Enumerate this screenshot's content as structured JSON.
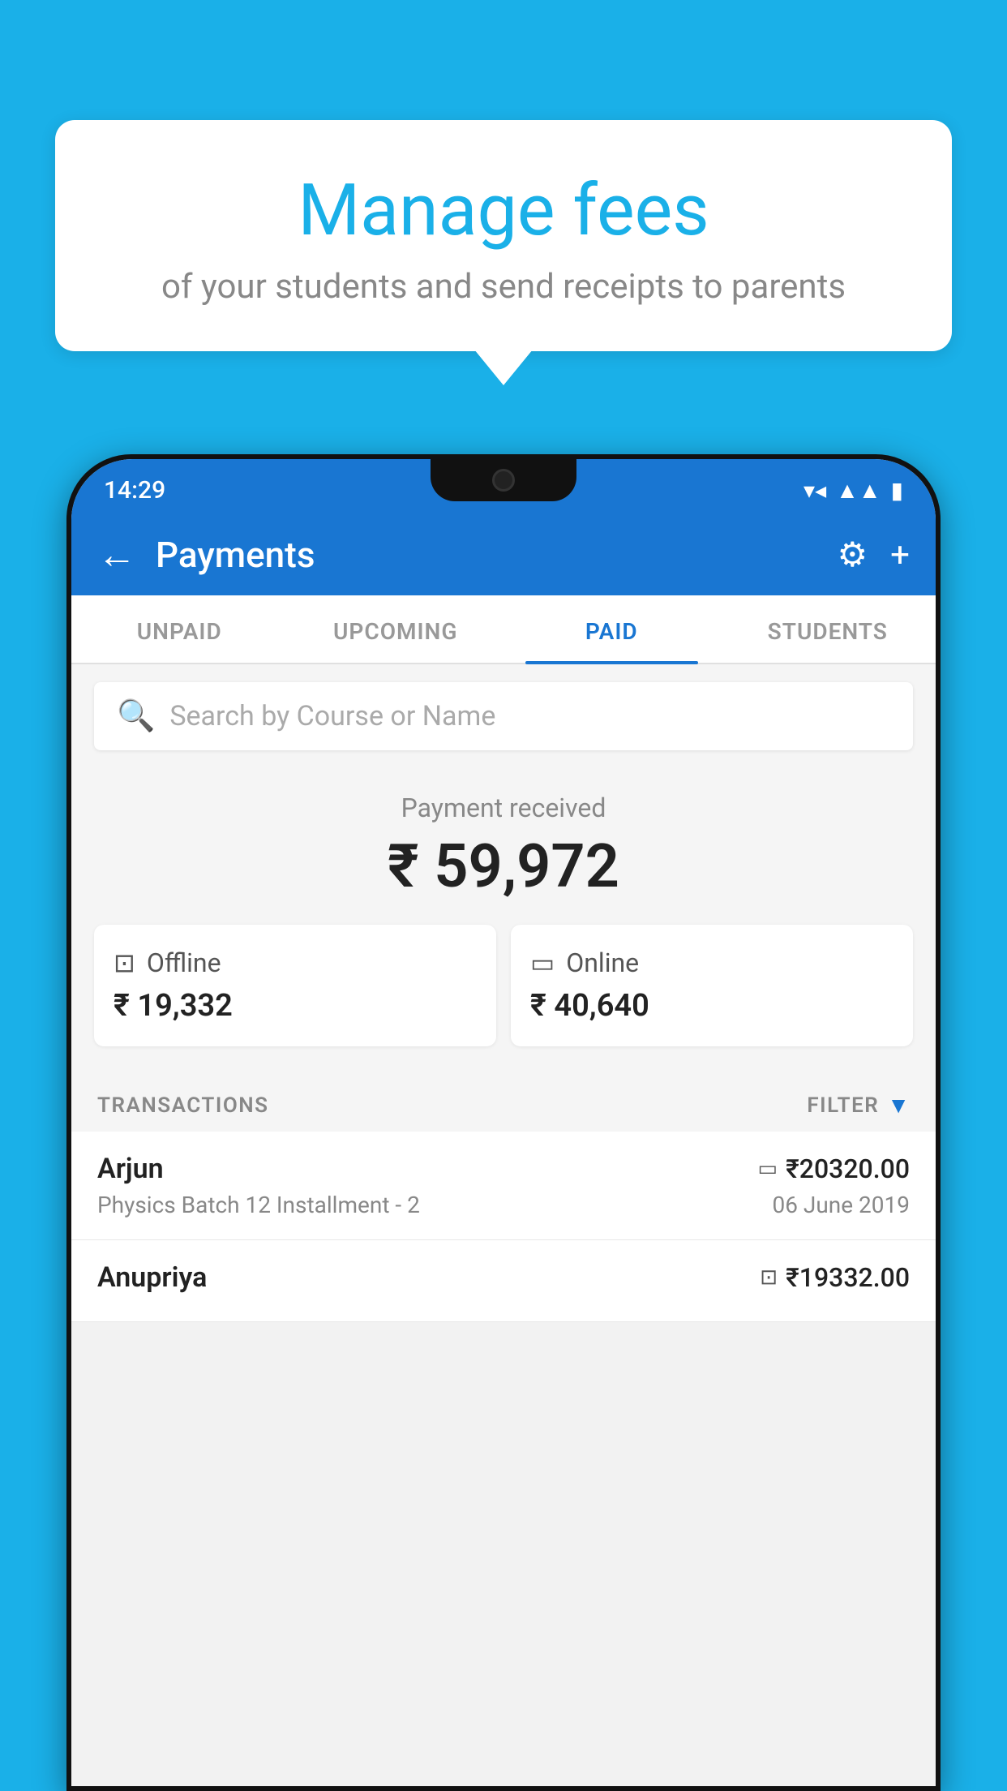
{
  "background": {
    "color": "#1ab0e8"
  },
  "speech_bubble": {
    "heading": "Manage fees",
    "subtext": "of your students and send receipts to parents"
  },
  "status_bar": {
    "time": "14:29",
    "wifi_icon": "▼▲",
    "signal": "▲",
    "battery": "▮"
  },
  "app_bar": {
    "title": "Payments",
    "back_label": "←",
    "gear_label": "⚙",
    "plus_label": "+"
  },
  "tabs": [
    {
      "label": "UNPAID",
      "active": false
    },
    {
      "label": "UPCOMING",
      "active": false
    },
    {
      "label": "PAID",
      "active": true
    },
    {
      "label": "STUDENTS",
      "active": false
    }
  ],
  "search": {
    "placeholder": "Search by Course or Name"
  },
  "payment_summary": {
    "received_label": "Payment received",
    "total_amount": "₹ 59,972",
    "offline_label": "Offline",
    "offline_amount": "₹ 19,332",
    "online_label": "Online",
    "online_amount": "₹ 40,640"
  },
  "transactions_section": {
    "label": "TRANSACTIONS",
    "filter_label": "FILTER"
  },
  "transactions": [
    {
      "name": "Arjun",
      "amount": "₹20320.00",
      "course": "Physics Batch 12 Installment - 2",
      "date": "06 June 2019",
      "payment_type": "card"
    },
    {
      "name": "Anupriya",
      "amount": "₹19332.00",
      "course": "",
      "date": "",
      "payment_type": "cash"
    }
  ]
}
